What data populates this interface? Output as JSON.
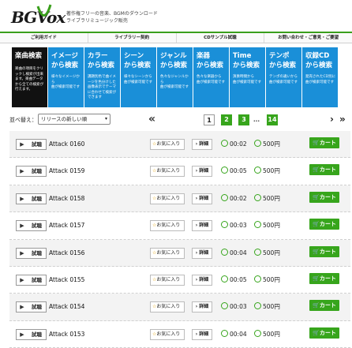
{
  "header": {
    "logo_text": "BGVox",
    "tagline_1": "著作権フリーの音楽、BGMのダウンロード",
    "tagline_2": "ライブラリミュージック販売"
  },
  "topnav": [
    {
      "label": "ご利用ガイド"
    },
    {
      "label": "ライブラリー契約"
    },
    {
      "label": "CDサンプル試聴"
    },
    {
      "label": "お問い合わせ・ご意見・ご要望"
    }
  ],
  "tabs": [
    {
      "title": "楽曲検索",
      "desc": "楽曲の項目をクリックし検索が出来ます。楽曲データから全ての検索が行えます。",
      "active": true
    },
    {
      "title": "イメージ\nから検索",
      "desc": "様々なイメージから\n曲が検索可能です"
    },
    {
      "title": "カラー\nから検索",
      "desc": "課題別色で曲イメージを色分けした画像表示でテーマに合わせて検索ができます"
    },
    {
      "title": "シーン\nから検索",
      "desc": "様々なシーンから\n曲が検索可能です"
    },
    {
      "title": "ジャンル\nから検索",
      "desc": "色々なジャンルから\n曲が検索可能です"
    },
    {
      "title": "楽器\nから検索",
      "desc": "色々な楽器から\n曲が検索可能です"
    },
    {
      "title": "Time\nから検索",
      "desc": "演奏時間から\n曲が検索可能です"
    },
    {
      "title": "テンポ\nから検索",
      "desc": "テンポの違いから\n曲が検索可能です"
    },
    {
      "title": "収録CD\nから検索",
      "desc": "発売されたCD別に\n曲が検索可能です"
    }
  ],
  "sort": {
    "label": "並べ替え：",
    "selected": "リリースの新しい順"
  },
  "pager": {
    "prev": "«",
    "pages": [
      "1",
      "2",
      "3",
      "…",
      "14"
    ],
    "next": "›",
    "last": "»"
  },
  "row_labels": {
    "play": "▶",
    "trial": "試聴",
    "favorite": "お気に入り",
    "detail": "詳細",
    "cart": "カート"
  },
  "tracks": [
    {
      "name": "Attack 0160",
      "duration": "00:02",
      "price": "500円"
    },
    {
      "name": "Attack 0159",
      "duration": "00:05",
      "price": "500円"
    },
    {
      "name": "Attack 0158",
      "duration": "00:02",
      "price": "500円"
    },
    {
      "name": "Attack 0157",
      "duration": "00:03",
      "price": "500円"
    },
    {
      "name": "Attack 0156",
      "duration": "00:04",
      "price": "500円"
    },
    {
      "name": "Attack 0155",
      "duration": "00:05",
      "price": "500円"
    },
    {
      "name": "Attack 0154",
      "duration": "00:03",
      "price": "500円"
    },
    {
      "name": "Attack 0153",
      "duration": "00:04",
      "price": "500円"
    }
  ],
  "colors": {
    "accent_green": "#37a51c",
    "tab_blue": "#1a8fd8",
    "tab_active": "#111111"
  }
}
